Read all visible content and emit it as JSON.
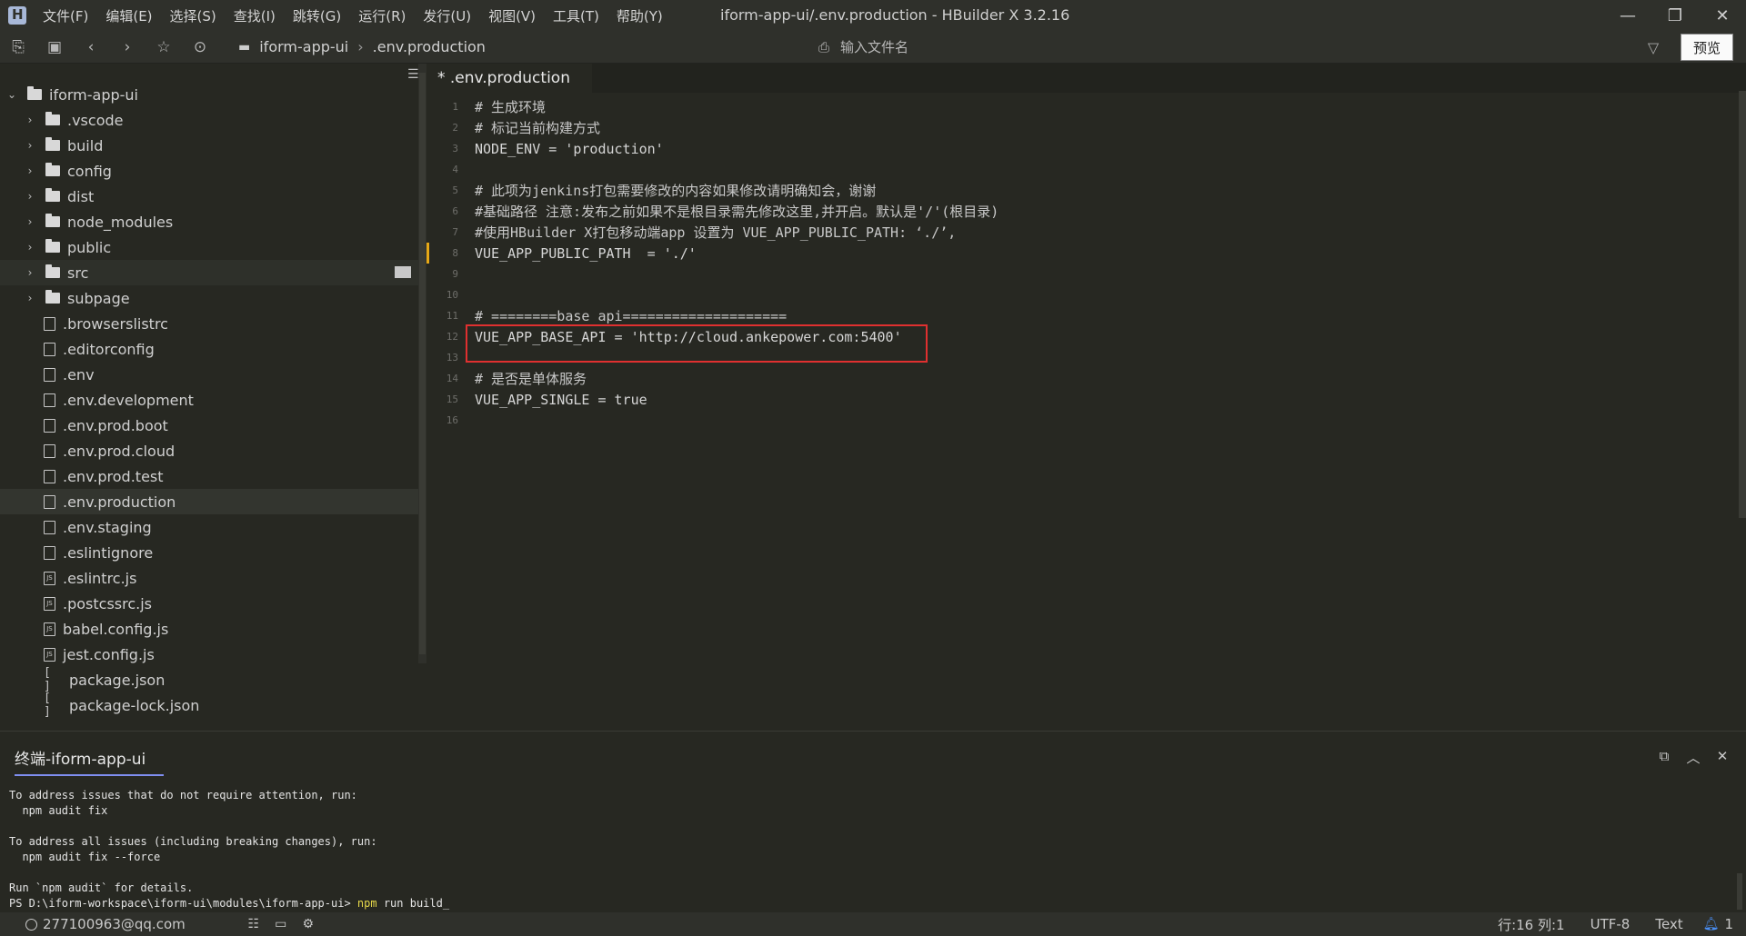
{
  "window": {
    "title": "iform-app-ui/.env.production - HBuilder X 3.2.16",
    "menus": [
      "文件(F)",
      "编辑(E)",
      "选择(S)",
      "查找(I)",
      "跳转(G)",
      "运行(R)",
      "发行(U)",
      "视图(V)",
      "工具(T)",
      "帮助(Y)"
    ],
    "controls": {
      "minimize": "—",
      "maximize": "❐",
      "close": "✕"
    }
  },
  "toolbar": {
    "breadcrumb": [
      "iform-app-ui",
      ".env.production"
    ],
    "file_search_placeholder": "输入文件名",
    "preview_label": "预览"
  },
  "sidebar": {
    "root": "iform-app-ui",
    "items": [
      {
        "name": ".vscode",
        "type": "folder"
      },
      {
        "name": "build",
        "type": "folder"
      },
      {
        "name": "config",
        "type": "folder"
      },
      {
        "name": "dist",
        "type": "folder"
      },
      {
        "name": "node_modules",
        "type": "folder"
      },
      {
        "name": "public",
        "type": "folder"
      },
      {
        "name": "src",
        "type": "folder"
      },
      {
        "name": "subpage",
        "type": "folder"
      },
      {
        "name": ".browserslistrc",
        "type": "file"
      },
      {
        "name": ".editorconfig",
        "type": "file"
      },
      {
        "name": ".env",
        "type": "file"
      },
      {
        "name": ".env.development",
        "type": "file"
      },
      {
        "name": ".env.prod.boot",
        "type": "file"
      },
      {
        "name": ".env.prod.cloud",
        "type": "file"
      },
      {
        "name": ".env.prod.test",
        "type": "file"
      },
      {
        "name": ".env.production",
        "type": "file"
      },
      {
        "name": ".env.staging",
        "type": "file"
      },
      {
        "name": ".eslintignore",
        "type": "file"
      },
      {
        "name": ".eslintrc.js",
        "type": "js"
      },
      {
        "name": ".postcssrc.js",
        "type": "js"
      },
      {
        "name": "babel.config.js",
        "type": "js"
      },
      {
        "name": "jest.config.js",
        "type": "js"
      },
      {
        "name": "package.json",
        "type": "json"
      },
      {
        "name": "package-lock.json",
        "type": "json"
      }
    ]
  },
  "editor": {
    "tab_label": "* .env.production",
    "lines": [
      {
        "n": "1",
        "text": "# 生成环境"
      },
      {
        "n": "2",
        "text": "# 标记当前构建方式"
      },
      {
        "n": "3",
        "text": "NODE_ENV = 'production'"
      },
      {
        "n": "4",
        "text": ""
      },
      {
        "n": "5",
        "text": "# 此项为jenkins打包需要修改的内容如果修改请明确知会，谢谢"
      },
      {
        "n": "6",
        "text": "#基础路径 注意:发布之前如果不是根目录需先修改这里,并开启。默认是'/'(根目录)"
      },
      {
        "n": "7",
        "text": "#使用HBuilder X打包移动端app 设置为 VUE_APP_PUBLIC_PATH: ‘./’,"
      },
      {
        "n": "8",
        "text": "VUE_APP_PUBLIC_PATH  = './'"
      },
      {
        "n": "9",
        "text": ""
      },
      {
        "n": "10",
        "text": ""
      },
      {
        "n": "11",
        "text": "# ========base api===================="
      },
      {
        "n": "12",
        "text": "VUE_APP_BASE_API = 'http://cloud.ankepower.com:5400'"
      },
      {
        "n": "13",
        "text": ""
      },
      {
        "n": "14",
        "text": "# 是否是单体服务"
      },
      {
        "n": "15",
        "text": "VUE_APP_SINGLE = true"
      },
      {
        "n": "16",
        "text": ""
      }
    ]
  },
  "terminal": {
    "tab_label": "终端-iform-app-ui",
    "lines": [
      "To address issues that do not require attention, run:",
      "  npm audit fix",
      "",
      "To address all issues (including breaking changes), run:",
      "  npm audit fix --force",
      "",
      "Run `npm audit` for details."
    ],
    "prompt": "PS D:\\iform-workspace\\iform-ui\\modules\\iform-app-ui> ",
    "command": "npm",
    "command_rest": " run build_"
  },
  "statusbar": {
    "user": "277100963@qq.com",
    "position": "行:16  列:1",
    "encoding": "UTF-8",
    "language": "Text",
    "notifications": "1"
  },
  "colors": {
    "background": "#272822",
    "highlight_box": "#e03030",
    "modified_marker": "#e6a817",
    "command_yellow": "#e6d84a"
  }
}
